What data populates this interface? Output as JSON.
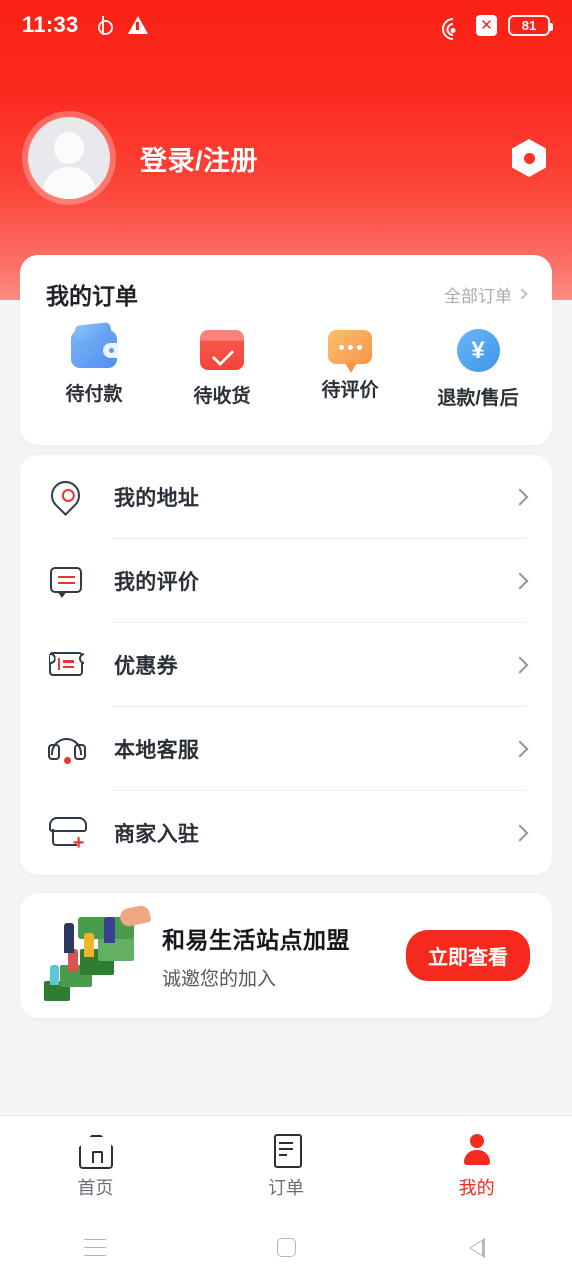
{
  "status_bar": {
    "time": "11:33",
    "location_icon": "location-icon",
    "warning_icon": "warning-triangle-icon",
    "wifi_icon": "wifi-icon",
    "no_sim_icon": "no-sim-icon",
    "no_sim_glyph": "✕",
    "battery_level": "81"
  },
  "profile": {
    "login_label": "登录/注册",
    "avatar_icon": "default-avatar-icon",
    "settings_icon": "settings-gear-icon"
  },
  "orders": {
    "title": "我的订单",
    "all_orders_label": "全部订单",
    "items": [
      {
        "label": "待付款",
        "icon": "wallet-icon"
      },
      {
        "label": "待收货",
        "icon": "box-check-icon"
      },
      {
        "label": "待评价",
        "icon": "comment-bubble-icon"
      },
      {
        "label": "退款/售后",
        "icon": "yen-refund-icon",
        "glyph": "¥"
      }
    ]
  },
  "menu": {
    "items": [
      {
        "label": "我的地址",
        "icon": "map-pin-icon"
      },
      {
        "label": "我的评价",
        "icon": "comment-lines-icon"
      },
      {
        "label": "优惠券",
        "icon": "coupon-ticket-icon"
      },
      {
        "label": "本地客服",
        "icon": "headset-support-icon"
      },
      {
        "label": "商家入驻",
        "icon": "storefront-add-icon",
        "badge": "+"
      }
    ]
  },
  "promo": {
    "title": "和易生活站点加盟",
    "subtitle": "诚邀您的加入",
    "button_label": "立即查看",
    "illustration": "money-stairs-people-illustration"
  },
  "tabbar": {
    "tabs": [
      {
        "label": "首页",
        "icon": "home-icon",
        "active": false
      },
      {
        "label": "订单",
        "icon": "orders-document-icon",
        "active": false
      },
      {
        "label": "我的",
        "icon": "user-profile-icon",
        "active": true
      }
    ]
  },
  "nav_bar": {
    "recents_icon": "recents-icon",
    "home_icon": "home-square-icon",
    "back_icon": "back-triangle-icon"
  },
  "colors": {
    "brand_red": "#f5291c",
    "header_gradient_top": "#fa2116",
    "header_gradient_bottom": "#fd8d85",
    "text_dark": "#2b3038",
    "text_muted": "#a8abb2",
    "page_bg": "#f4f4f6"
  }
}
